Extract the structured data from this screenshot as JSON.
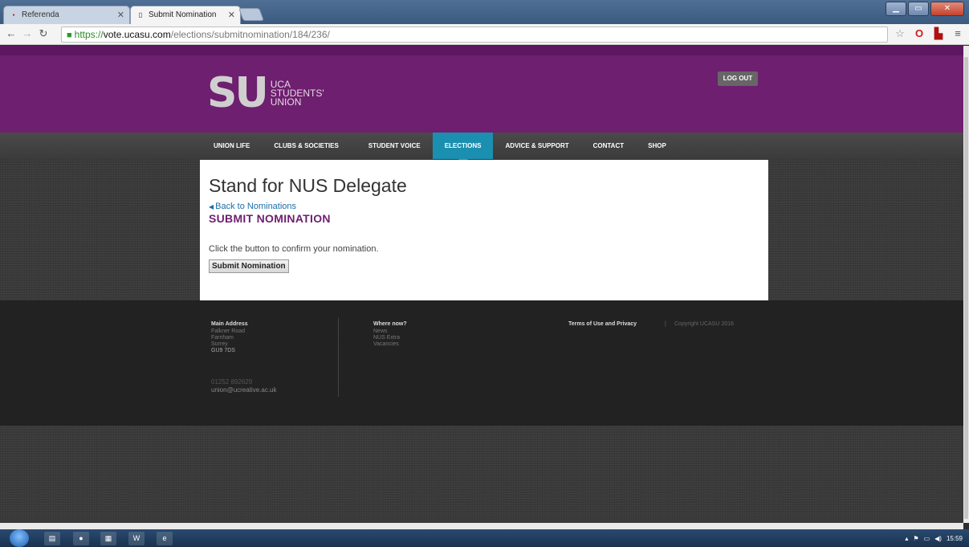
{
  "browser": {
    "tabs": [
      {
        "title": "Referenda",
        "icon": "ras-favicon-icon",
        "active": false
      },
      {
        "title": "Submit Nomination",
        "icon": "page-icon",
        "active": true
      }
    ],
    "url": {
      "scheme": "https://",
      "host": "vote.ucasu.com",
      "path": "/elections/submitnomination/184/236/"
    }
  },
  "header": {
    "logo_mark": "SU",
    "logo_line1": "UCA",
    "logo_line2": "STUDENTS'",
    "logo_line3": "UNION",
    "logout_label": "LOG OUT"
  },
  "nav": {
    "items": [
      {
        "label": "UNION LIFE"
      },
      {
        "label": "CLUBS & SOCIETIES"
      },
      {
        "label": "STUDENT VOICE"
      },
      {
        "label": "ELECTIONS",
        "active": true
      },
      {
        "label": "ADVICE & SUPPORT"
      },
      {
        "label": "CONTACT"
      },
      {
        "label": "SHOP"
      }
    ]
  },
  "main": {
    "title": "Stand for NUS Delegate",
    "back_link": "Back to Nominations",
    "section_heading": "SUBMIT NOMINATION",
    "instruction": "Click the button to confirm your nomination.",
    "submit_label": "Submit Nomination"
  },
  "footer": {
    "address_heading": "Main Address",
    "address_lines": [
      "Falkner Road",
      "Farnham",
      "Surrey",
      "GU9 7DS"
    ],
    "phone": "01252 892629",
    "email": "union@ucreative.ac.uk",
    "where_heading": "Where now?",
    "where_links": [
      "News",
      "NUS Extra",
      "Vacancies"
    ],
    "terms": "Terms of Use and Privacy",
    "separator": "|",
    "copyright": "Copyright UCASU 2016"
  },
  "taskbar": {
    "clock": "15:59"
  },
  "colors": {
    "brand_purple": "#6e1f6f",
    "nav_active": "#1b8fb0",
    "link_blue": "#1b6fa8"
  }
}
